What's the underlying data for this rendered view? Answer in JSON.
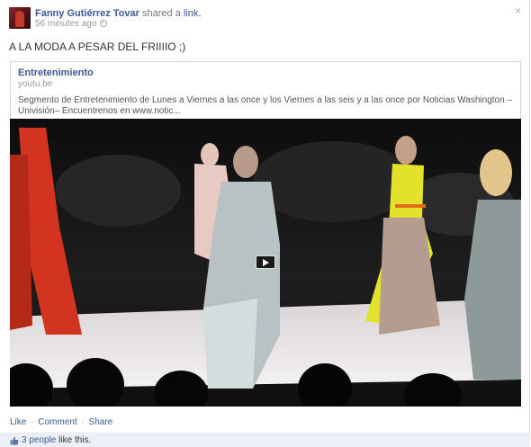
{
  "post": {
    "author": "Fanny Gutiérrez Tovar",
    "shared_text": "shared a",
    "link_word": "link.",
    "timestamp": "56 minutes ago",
    "close_glyph": "×",
    "status": "A LA MODA A PESAR DEL FRIIIIO ;)"
  },
  "link_preview": {
    "title": "Entretenimiento",
    "domain": "youtu.be",
    "description": "Segmento de Entretenimiento de Lunes a Viernes a las once y los Viernes a las seis y a las once por Noticias Washington – Univisión– Encuentrenos en www.notic..."
  },
  "actions": {
    "like": "Like",
    "comment": "Comment",
    "share": "Share",
    "separator": "·"
  },
  "likes": {
    "count": "3 people",
    "suffix": "like this."
  },
  "colors": {
    "link_blue": "#3b5998",
    "likes_bar": "#eceff5"
  },
  "icons": [
    "globe-icon",
    "close-icon",
    "play-icon",
    "thumbs-up-icon"
  ]
}
